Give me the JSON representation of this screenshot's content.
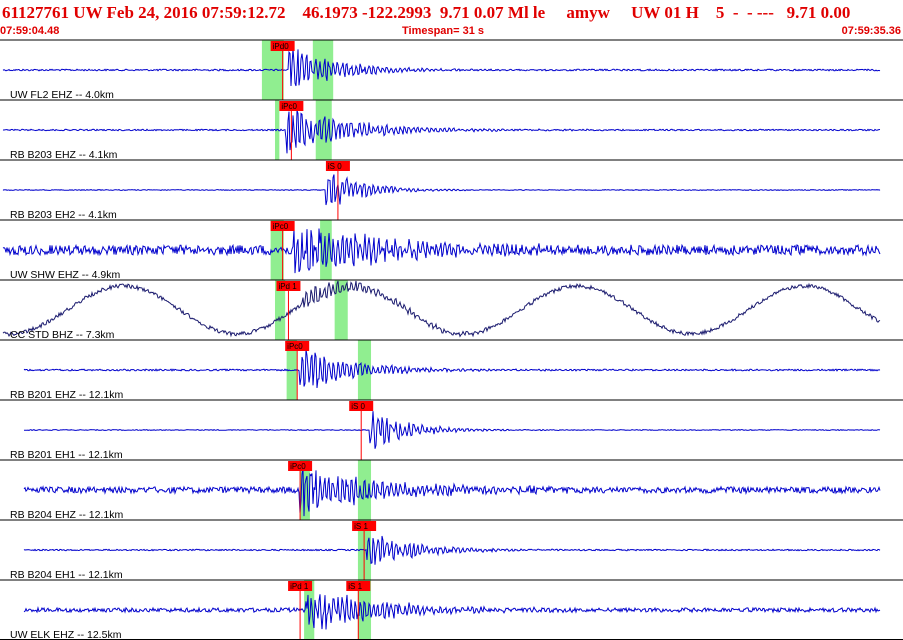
{
  "header": {
    "event_line": "61127761 UW Feb 24, 2016 07:59:12.72    46.1973 -122.2993  9.71 0.07 Ml le     amyw     UW 01 H    5  -  - ---   9.71 0.00",
    "start_time": "07:59:04.48",
    "timespan": "Timespan=  31 s",
    "end_time": "07:59:35.36"
  },
  "chart_data": {
    "type": "line",
    "title": "61127761 UW Feb 24, 2016 07:59:12.72",
    "x_start": "07:59:04.48",
    "x_end": "07:59:35.36",
    "timespan_s": 31,
    "colors": {
      "trace": "#0000cc",
      "trace_long_period": "#1a1a6e",
      "pick": "#ff0000",
      "window": "#90ee90",
      "divider": "#000000",
      "header": "#e00000"
    },
    "traces": [
      {
        "label": "UW FL2 EHZ -- 4.0km",
        "noise": 0.06,
        "burst_start": 9.9,
        "burst_amp": 0.9,
        "burst_decay": 1.6,
        "picks": [
          {
            "label": "iPd0",
            "t": 9.3
          }
        ],
        "windows": [
          [
            9.0,
            9.75
          ],
          [
            10.75,
            11.45
          ]
        ]
      },
      {
        "label": "RB B203 EHZ -- 4.1km",
        "noise": 0.05,
        "burst_start": 9.8,
        "burst_amp": 1.0,
        "burst_decay": 2.2,
        "picks": [
          {
            "label": "iPc0",
            "t": 9.6
          }
        ],
        "windows": [
          [
            9.45,
            9.6
          ],
          [
            10.85,
            11.4
          ]
        ]
      },
      {
        "label": "RB B203 EH2 -- 4.1km",
        "noise": 0.03,
        "burst_start": 11.2,
        "burst_amp": 0.8,
        "burst_decay": 1.2,
        "picks": [
          {
            "label": "iS 0",
            "t": 11.2
          }
        ],
        "windows": []
      },
      {
        "label": "UW SHW EHZ -- 4.9km",
        "noise": 0.35,
        "burst_start": 10.1,
        "burst_amp": 1.0,
        "burst_decay": 3.2,
        "picks": [
          {
            "label": "iPc0",
            "t": 9.3
          }
        ],
        "windows": [
          [
            9.3,
            9.75
          ],
          [
            11.0,
            11.4
          ]
        ]
      },
      {
        "label": "CC STD BHZ -- 7.3km",
        "noise": 0.14,
        "burst_start": 10.4,
        "burst_amp": 0.4,
        "burst_decay": 2.5,
        "picks": [
          {
            "label": "iPd 1",
            "t": 9.5
          }
        ],
        "windows": [
          [
            9.45,
            9.8
          ],
          [
            11.5,
            11.95
          ]
        ]
      },
      {
        "label": "RB B201 EHZ -- 12.1km",
        "noise": 0.06,
        "burst_start": 10.3,
        "burst_amp": 0.9,
        "burst_decay": 1.8,
        "picks": [
          {
            "label": "iPc0",
            "t": 9.8
          }
        ],
        "windows": [
          [
            9.85,
            10.2
          ],
          [
            12.3,
            12.75
          ]
        ]
      },
      {
        "label": "RB B201 EH1 -- 12.1km",
        "noise": 0.03,
        "burst_start": 12.7,
        "burst_amp": 0.8,
        "burst_decay": 1.3,
        "picks": [
          {
            "label": "iS 0",
            "t": 12.0
          }
        ],
        "windows": []
      },
      {
        "label": "RB B204 EHZ -- 12.1km",
        "noise": 0.22,
        "burst_start": 10.3,
        "burst_amp": 1.0,
        "burst_decay": 2.6,
        "picks": [
          {
            "label": "iPc0",
            "t": 9.9
          }
        ],
        "windows": [
          [
            10.3,
            10.65
          ],
          [
            12.3,
            12.75
          ]
        ]
      },
      {
        "label": "RB B204 EH1 -- 12.1km",
        "noise": 0.05,
        "burst_start": 12.6,
        "burst_amp": 0.7,
        "burst_decay": 1.6,
        "picks": [
          {
            "label": "iS 1",
            "t": 12.1
          }
        ],
        "windows": [
          [
            12.3,
            12.75
          ]
        ]
      },
      {
        "label": "UW ELK EHZ -- 12.5km",
        "noise": 0.15,
        "burst_start": 10.5,
        "burst_amp": 0.9,
        "burst_decay": 2.4,
        "picks": [
          {
            "label": "iPd 1",
            "t": 9.9
          },
          {
            "label": "iS 1",
            "t": 11.9
          }
        ],
        "windows": [
          [
            10.45,
            10.8
          ],
          [
            12.3,
            12.75
          ]
        ]
      }
    ]
  }
}
